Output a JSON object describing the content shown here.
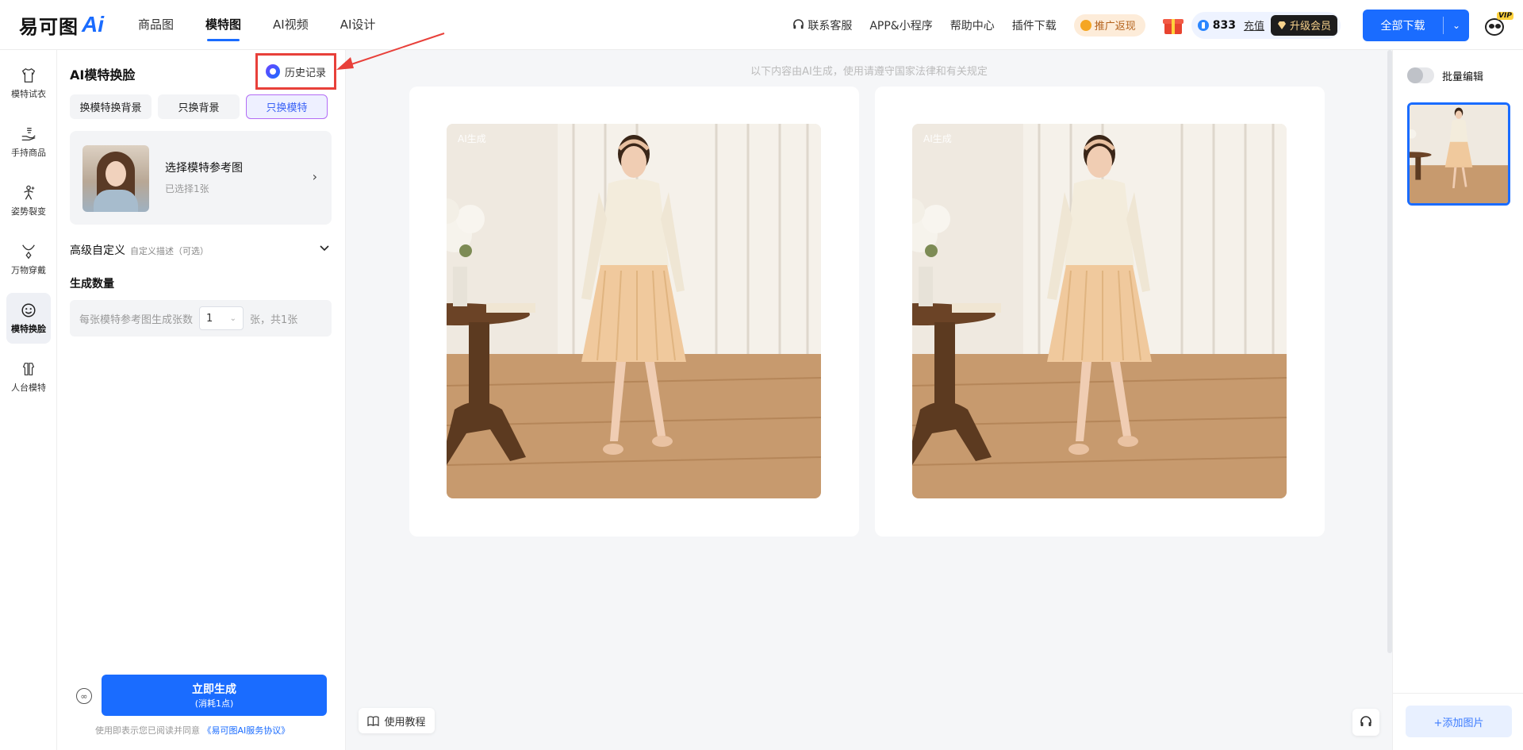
{
  "brand": {
    "logo_text": "易可图",
    "logo_ai": "Ai"
  },
  "nav": [
    {
      "label": "商品图"
    },
    {
      "label": "模特图"
    },
    {
      "label": "AI视频"
    },
    {
      "label": "AI设计"
    }
  ],
  "topbar": {
    "support": "联系客服",
    "app": "APP&小程序",
    "help": "帮助中心",
    "plugin": "插件下载",
    "promo": "推广返现",
    "credits": "833",
    "recharge": "充值",
    "upgrade": "升级会员",
    "download_all": "全部下载",
    "vip_badge": "VIP"
  },
  "iconbar": [
    {
      "label": "模特试衣",
      "icon": "shirt-icon"
    },
    {
      "label": "手持商品",
      "icon": "hand-icon"
    },
    {
      "label": "姿势裂变",
      "icon": "pose-icon"
    },
    {
      "label": "万物穿戴",
      "icon": "necklace-icon"
    },
    {
      "label": "模特换脸",
      "icon": "smile-icon"
    },
    {
      "label": "人台模特",
      "icon": "mannequin-icon"
    }
  ],
  "panel": {
    "title": "AI模特换脸",
    "history": "历史记录",
    "tabs": [
      "换模特换背景",
      "只换背景",
      "只换模特"
    ],
    "model_card": {
      "title": "选择模特参考图",
      "sub": "已选择1张"
    },
    "advanced": {
      "title": "高级自定义",
      "sub": "自定义描述（可选）"
    },
    "count": {
      "title": "生成数量",
      "prefix": "每张模特参考图生成张数",
      "value": "1",
      "suffix": "张，共1张"
    },
    "generate": {
      "label": "立即生成",
      "cost": "(消耗1点)"
    },
    "agreement_prefix": "使用即表示您已阅读并同意",
    "agreement_link": "《易可图AI服务协议》"
  },
  "main": {
    "notice": "以下内容由AI生成，使用请遵守国家法律和有关规定",
    "images": [
      {
        "tag": "AI生成"
      },
      {
        "tag": "AI生成"
      }
    ],
    "tutorial": "使用教程"
  },
  "rpanel": {
    "batch_edit": "批量编辑",
    "add_image": "+添加图片"
  },
  "colors": {
    "accent": "#1a6cff",
    "annotation": "#e8403a",
    "vip_gold": "#f7d28c"
  }
}
